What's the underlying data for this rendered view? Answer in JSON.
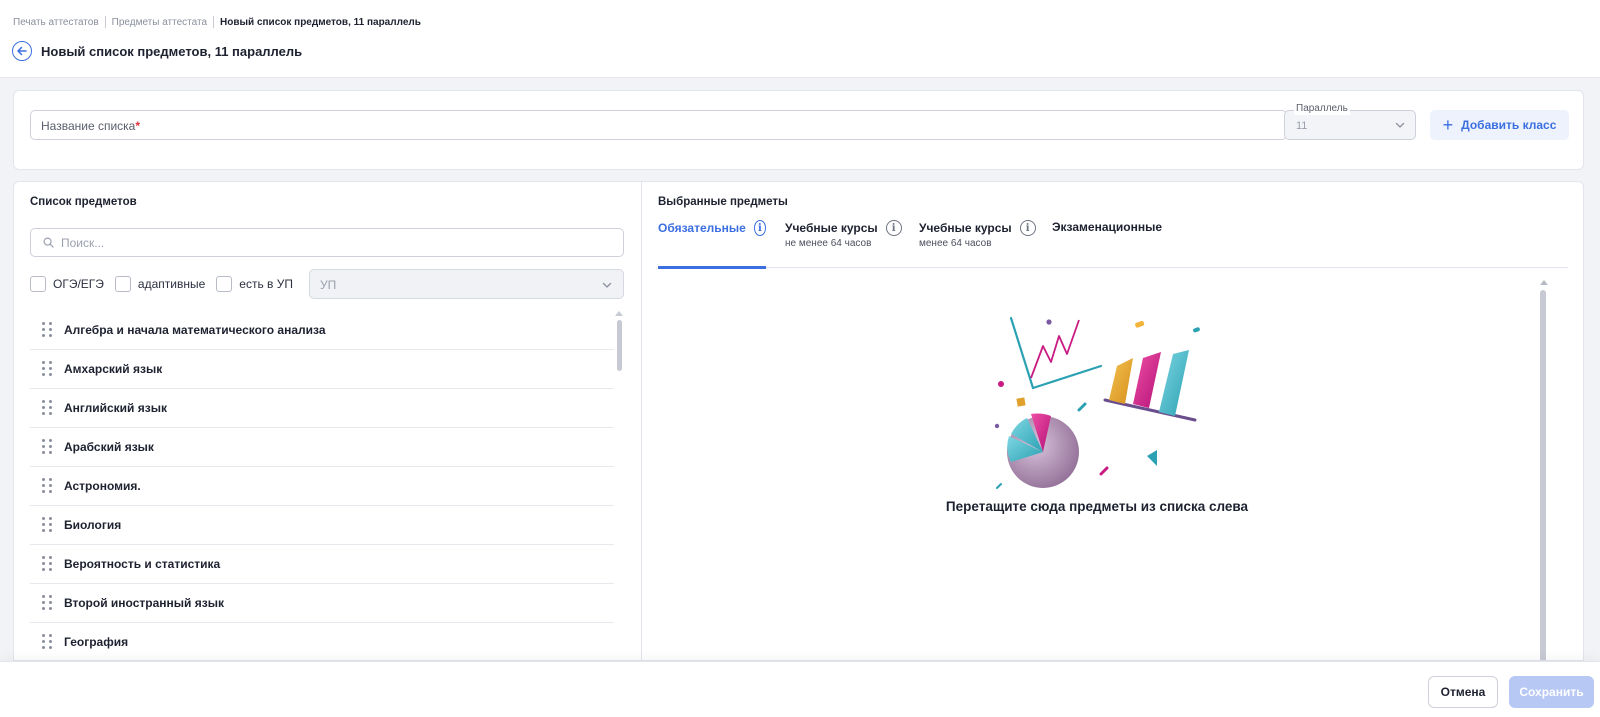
{
  "breadcrumb": [
    "Печать аттестатов",
    "Предметы аттестата",
    "Новый список предметов, 11 параллель"
  ],
  "page_title": "Новый список предметов, 11 параллель",
  "form": {
    "name_placeholder": "Название списка",
    "required_mark": "*",
    "parallel_label": "Параллель",
    "parallel_value": "11",
    "add_class_label": "Добавить класс"
  },
  "subjects": {
    "title": "Список предметов",
    "search_placeholder": "Поиск...",
    "filters": [
      "ОГЭ/ЕГЭ",
      "адаптивные",
      "есть в УП"
    ],
    "up_select_value": "УП",
    "items": [
      "Алгебра и начала математического анализа",
      "Амхарский язык",
      "Английский язык",
      "Арабский язык",
      "Астрономия.",
      "Биология",
      "Вероятность и статистика",
      "Второй иностранный язык",
      "География"
    ]
  },
  "selected": {
    "title": "Выбранные предметы",
    "tabs": [
      {
        "label": "Обязательные",
        "sub": ""
      },
      {
        "label": "Учебные курсы",
        "sub": "не менее 64 часов"
      },
      {
        "label": "Учебные курсы",
        "sub": "менее 64 часов"
      },
      {
        "label": "Экзаменационные",
        "sub": ""
      }
    ],
    "empty_text": "Перетащите сюда предметы из списка слева"
  },
  "footer": {
    "cancel_label": "Отмена",
    "save_label": "Сохранить"
  },
  "colors": {
    "accent": "#3b6fe0",
    "save_disabled": "#b7c8f5",
    "required": "#e0323c"
  }
}
